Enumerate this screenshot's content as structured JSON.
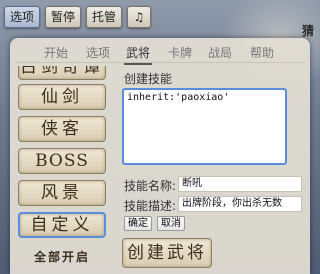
{
  "topbar": {
    "buttons": [
      "选项",
      "暂停",
      "托管"
    ],
    "music_icon": "♫"
  },
  "background": {
    "corner_text": "猜"
  },
  "tabs": [
    "开始",
    "选项",
    "武将",
    "卡牌",
    "战局",
    "帮助"
  ],
  "left_list": {
    "items": [
      "古剑奇谭",
      "仙剑",
      "侠客",
      "BOSS",
      "风景",
      "自定义"
    ],
    "footer": "全部开启"
  },
  "skill": {
    "title": "创建技能",
    "code": "inherit:'paoxiao'",
    "name_label": "技能名称:",
    "name_value": "断吼",
    "desc_label": "技能描述:",
    "desc_value": "出牌阶段，你出杀无数",
    "confirm": "确定",
    "cancel": "取消"
  },
  "create_button": "创建武将"
}
